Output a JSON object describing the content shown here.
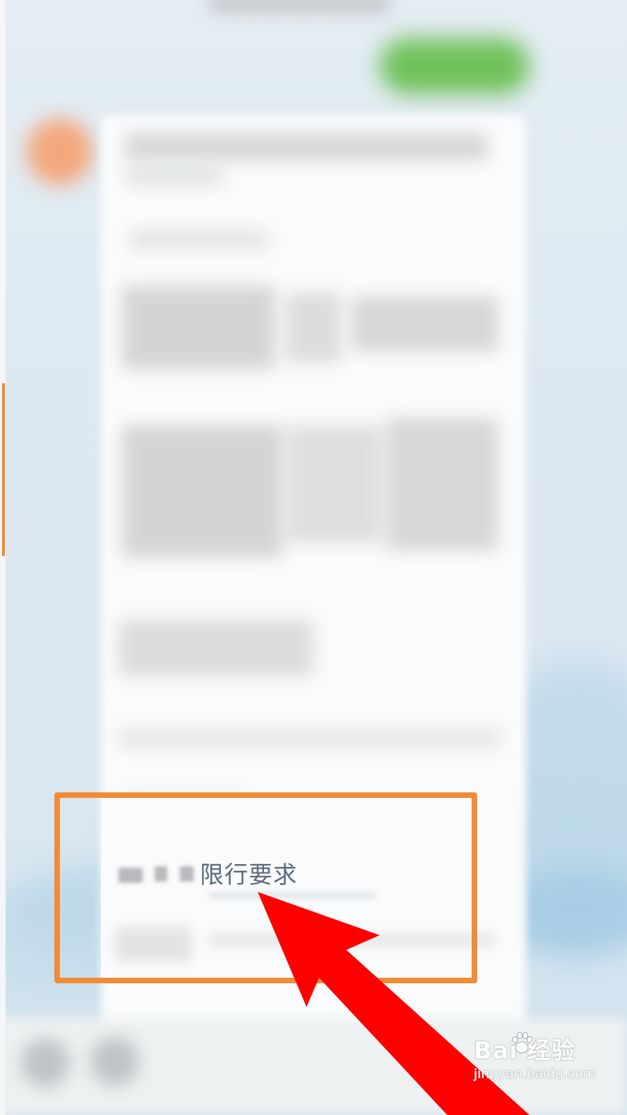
{
  "list": {
    "highlighted_item": {
      "label": "限行要求"
    }
  },
  "watermark": {
    "logo_text": "Bai 经验",
    "url": "jingyan.baidu.com"
  },
  "colors": {
    "highlight_border": "#f18b37",
    "arrow": "#ff0000",
    "item_text": "#5c6b7d",
    "left_accent": "#f0892f"
  },
  "icons": [
    "arrow-pointer-icon",
    "paw-icon"
  ]
}
